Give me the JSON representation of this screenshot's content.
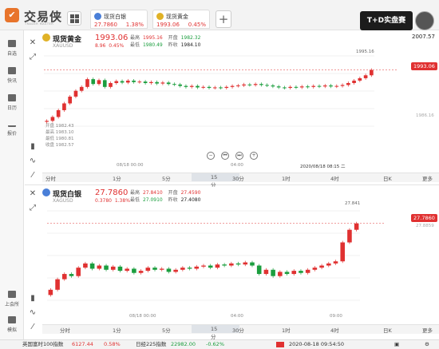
{
  "app": {
    "logo_glyph": "✔",
    "brand": "交易侠",
    "brand_sub": "TRADER MASTER",
    "banner": "T+D实盘赛"
  },
  "tabs": [
    {
      "name": "现货白银",
      "price": "27.7860",
      "change": "1.38%",
      "icon_color": "#4a7fd8"
    },
    {
      "name": "现货黄金",
      "price": "1993.06",
      "change": "0.45%",
      "icon_color": "#e0b227"
    }
  ],
  "toolbar": {
    "plus": "+",
    "account": "2007.57"
  },
  "sidebar": [
    {
      "label": "自选"
    },
    {
      "label": "快讯"
    },
    {
      "label": "日历"
    },
    {
      "label": "报价"
    },
    {
      "label": "上会所"
    },
    {
      "label": "模拟"
    }
  ],
  "gold": {
    "name": "现货黄金",
    "code": "XAUUSD",
    "price": "1993.06",
    "change": "8.96",
    "pct": "0.45%",
    "high_l": "最高",
    "high": "1995.16",
    "open_l": "开盘",
    "open": "1982.32",
    "low_l": "最低",
    "low": "1980.49",
    "prev_l": "昨收",
    "prev": "1984.10",
    "hover": {
      "open": "开盘 1982.43",
      "high": "最高 1983.10",
      "low": "最低 1980.81",
      "close": "收盘 1982.57"
    },
    "labels": {
      "peak": "1995.16",
      "low_line": "1986.16",
      "current": "1993.06",
      "date_l": "08/18 00:00",
      "time_m": "04:00",
      "cursor": "2020/08/18 08:15 二"
    }
  },
  "silver": {
    "name": "现货白银",
    "code": "XAGUSD",
    "price": "27.7860",
    "change": "0.3780",
    "pct": "1.38%",
    "high_l": "最高",
    "high": "27.8410",
    "open_l": "开盘",
    "open": "27.4590",
    "low_l": "最低",
    "low": "27.0910",
    "prev_l": "昨收",
    "prev": "27.4080",
    "labels": {
      "peak": "27.841",
      "current": "27.7860",
      "right": "27.8859",
      "date_l": "08/18 00:00",
      "time_m": "04:00",
      "time_r": "09:00"
    }
  },
  "periods": [
    "分时",
    "1分",
    "5分",
    "15分",
    "30分",
    "1时",
    "4时",
    "日K",
    "更多"
  ],
  "status": {
    "idx1": "英国富时100指数",
    "v1": "6127.44",
    "p1": "0.58%",
    "idx2": "日经225指数",
    "v2": "22982.00",
    "p2": "-0.62%",
    "datetime": "2020-08-18 09:54:50"
  },
  "colors": {
    "up": "#e03131",
    "down": "#1b9e3e"
  },
  "chart_data": [
    {
      "type": "candlestick",
      "title": "现货黄金 XAUUSD",
      "candles": [
        [
          1982.4,
          1982.6
        ],
        [
          1982.6,
          1983.4
        ],
        [
          1983.4,
          1984.8
        ],
        [
          1984.8,
          1986.2
        ],
        [
          1986.2,
          1987.6
        ],
        [
          1987.6,
          1988.8
        ],
        [
          1988.8,
          1989.6
        ],
        [
          1989.6,
          1991.2
        ],
        [
          1991.2,
          1990.2
        ],
        [
          1990.2,
          1991.0
        ],
        [
          1991.0,
          1989.6
        ],
        [
          1989.6,
          1990.4
        ],
        [
          1990.4,
          1990.8
        ],
        [
          1990.8,
          1990.5
        ],
        [
          1990.5,
          1990.9
        ],
        [
          1990.9,
          1990.6
        ],
        [
          1990.6,
          1990.7
        ],
        [
          1990.7,
          1990.4
        ],
        [
          1990.4,
          1990.6
        ],
        [
          1990.6,
          1990.3
        ],
        [
          1990.3,
          1990.5
        ],
        [
          1990.5,
          1990.2
        ],
        [
          1990.2,
          1990.1
        ],
        [
          1990.1,
          1989.8
        ],
        [
          1989.8,
          1989.6
        ],
        [
          1989.6,
          1989.8
        ],
        [
          1989.8,
          1989.5
        ],
        [
          1989.5,
          1989.6
        ],
        [
          1989.6,
          1989.4
        ],
        [
          1989.4,
          1989.5
        ],
        [
          1989.5,
          1989.4
        ],
        [
          1989.4,
          1989.6
        ],
        [
          1989.6,
          1989.8
        ],
        [
          1989.8,
          1989.9
        ],
        [
          1989.9,
          1990.1
        ],
        [
          1990.1,
          1990.0
        ],
        [
          1990.0,
          1990.2
        ],
        [
          1990.2,
          1990.0
        ],
        [
          1990.0,
          1989.9
        ],
        [
          1989.9,
          1989.7
        ],
        [
          1989.7,
          1989.5
        ],
        [
          1989.5,
          1989.4
        ],
        [
          1989.4,
          1989.6
        ],
        [
          1989.6,
          1989.5
        ],
        [
          1989.5,
          1989.7
        ],
        [
          1989.7,
          1989.6
        ],
        [
          1989.6,
          1989.8
        ],
        [
          1989.8,
          1989.7
        ],
        [
          1989.7,
          1989.9
        ],
        [
          1989.9,
          1989.7
        ],
        [
          1989.7,
          1989.8
        ],
        [
          1989.8,
          1990.0
        ],
        [
          1990.0,
          1990.4
        ],
        [
          1990.4,
          1990.9
        ],
        [
          1990.9,
          1991.4
        ],
        [
          1991.4,
          1992.0
        ],
        [
          1992.0,
          1993.1
        ]
      ],
      "ylim": [
        1981.5,
        1996.0
      ]
    },
    {
      "type": "candlestick",
      "title": "现货白银 XAGUSD",
      "candles": [
        [
          27.1,
          27.15
        ],
        [
          27.15,
          27.25
        ],
        [
          27.25,
          27.3
        ],
        [
          27.3,
          27.28
        ],
        [
          27.28,
          27.36
        ],
        [
          27.36,
          27.4
        ],
        [
          27.4,
          27.35
        ],
        [
          27.35,
          27.38
        ],
        [
          27.38,
          27.34
        ],
        [
          27.34,
          27.37
        ],
        [
          27.37,
          27.33
        ],
        [
          27.33,
          27.35
        ],
        [
          27.35,
          27.31
        ],
        [
          27.31,
          27.33
        ],
        [
          27.33,
          27.36
        ],
        [
          27.36,
          27.34
        ],
        [
          27.34,
          27.35
        ],
        [
          27.35,
          27.32
        ],
        [
          27.32,
          27.34
        ],
        [
          27.34,
          27.36
        ],
        [
          27.36,
          27.35
        ],
        [
          27.35,
          27.37
        ],
        [
          27.37,
          27.38
        ],
        [
          27.38,
          27.36
        ],
        [
          27.36,
          27.39
        ],
        [
          27.39,
          27.38
        ],
        [
          27.38,
          27.4
        ],
        [
          27.4,
          27.39
        ],
        [
          27.39,
          27.41
        ],
        [
          27.41,
          27.38
        ],
        [
          27.38,
          27.3
        ],
        [
          27.3,
          27.34
        ],
        [
          27.34,
          27.28
        ],
        [
          27.28,
          27.32
        ],
        [
          27.32,
          27.3
        ],
        [
          27.3,
          27.33
        ],
        [
          27.33,
          27.31
        ],
        [
          27.31,
          27.34
        ],
        [
          27.34,
          27.36
        ],
        [
          27.36,
          27.38
        ],
        [
          27.38,
          27.4
        ],
        [
          27.4,
          27.42
        ],
        [
          27.42,
          27.6
        ],
        [
          27.6,
          27.72
        ],
        [
          27.72,
          27.78
        ]
      ],
      "ylim": [
        27.05,
        27.9
      ]
    }
  ]
}
